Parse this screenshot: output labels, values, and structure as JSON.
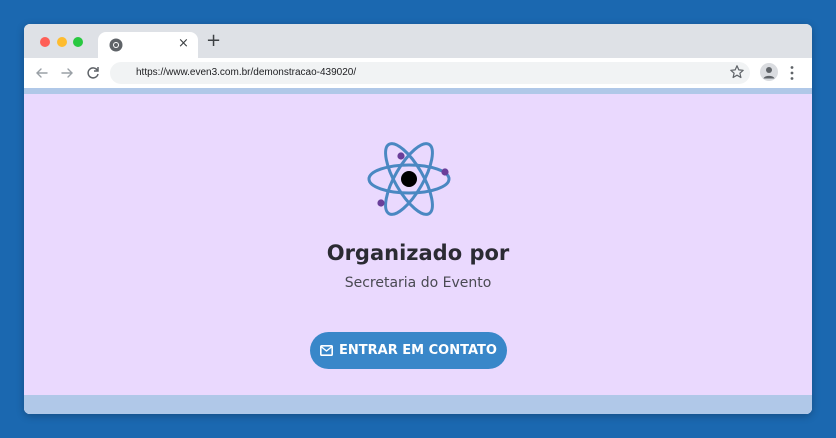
{
  "browser": {
    "tab": {
      "favicon": "chrome-icon",
      "close_glyph": "×"
    },
    "new_tab_glyph": "+",
    "address_bar": {
      "url": "https://www.even3.com.br/demonstracao-439020/"
    },
    "icons": [
      "back-arrow-icon",
      "forward-arrow-icon",
      "reload-icon",
      "star-icon",
      "profile-icon",
      "kebab-menu-icon"
    ]
  },
  "page": {
    "logo": "atom-icon",
    "title": "Organizado por",
    "organizer": "Secretaria do Evento",
    "contact_button": {
      "label": "ENTRAR EM CONTATO",
      "icon": "envelope-icon"
    }
  },
  "colors": {
    "desktop_bg": "#1b68b0",
    "page_bg": "#ead9fe",
    "accent_strip": "#b0c8e8",
    "button_bg": "#3987c9",
    "atom_orbit": "#4a88c2",
    "atom_electron": "#6a3f9a"
  }
}
